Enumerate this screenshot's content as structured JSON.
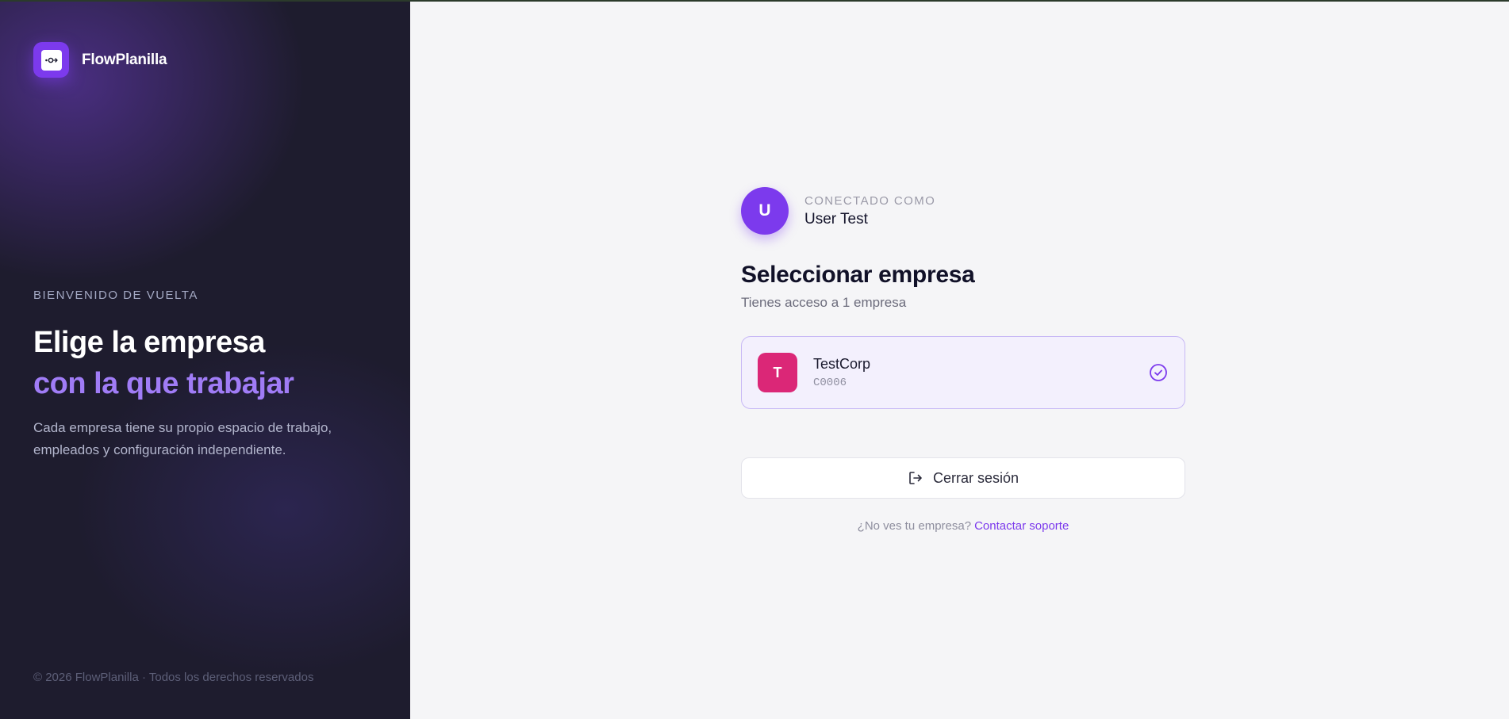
{
  "brand": {
    "name": "FlowPlanilla",
    "logo_icon": "logo-icon"
  },
  "hero": {
    "eyebrow": "BIENVENIDO DE VUELTA",
    "headline_line1": "Elige la empresa",
    "headline_line2": "con la que trabajar",
    "description": "Cada empresa tiene su propio espacio de trabajo, empleados y configuración independiente."
  },
  "footer": {
    "copyright": "© 2026 FlowPlanilla · Todos los derechos reservados"
  },
  "user": {
    "avatar_initial": "U",
    "connected_label": "CONECTADO COMO",
    "name": "User Test"
  },
  "selector": {
    "title": "Seleccionar empresa",
    "subtitle": "Tienes acceso a 1 empresa",
    "companies": [
      {
        "initial": "T",
        "name": "TestCorp",
        "code": "C0006",
        "selected": true,
        "badge_color": "#db2777"
      }
    ]
  },
  "actions": {
    "logout_label": "Cerrar sesión",
    "logout_icon": "logout-icon"
  },
  "support": {
    "prompt": "¿No ves tu empresa?",
    "link_label": "Contactar soporte"
  },
  "colors": {
    "accent": "#7c3aed",
    "accent_light": "#a07cf6",
    "left_panel_bg": "#1e1c2e",
    "right_panel_bg": "#f5f5f7"
  }
}
